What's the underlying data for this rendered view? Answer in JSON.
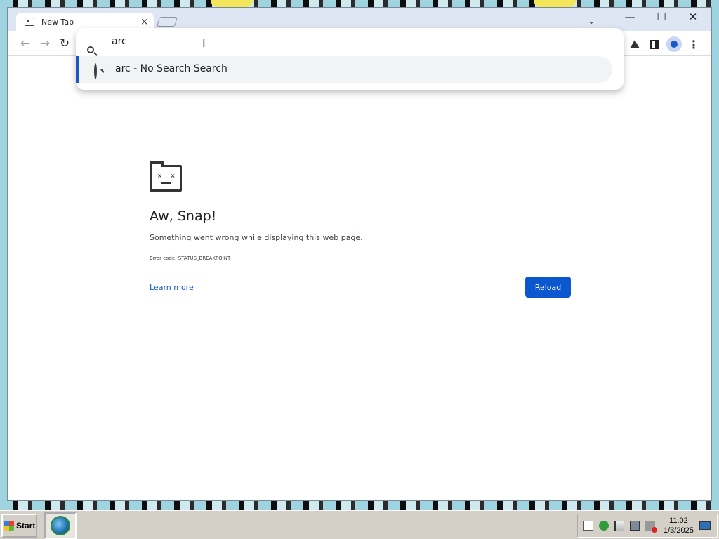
{
  "browser": {
    "tab": {
      "title": "New Tab",
      "close_label": "×"
    },
    "window_controls": {
      "minimize": "—",
      "maximize": "☐",
      "close": "✕"
    },
    "tab_search_label": "⌄",
    "nav": {
      "back": "←",
      "forward": "→",
      "reload": "↻"
    },
    "menu_label": "⋮"
  },
  "omnibox": {
    "query": "arc",
    "suggestion": "arc - No Search Search"
  },
  "error_page": {
    "title": "Aw, Snap!",
    "message": "Something went wrong while displaying this web page.",
    "error_code": "Error code: STATUS_BREAKPOINT",
    "learn_more": "Learn more",
    "reload_button": "Reload"
  },
  "taskbar": {
    "start_label": "Start",
    "clock_time": "11:02",
    "clock_date": "1/3/2025"
  },
  "colors": {
    "accent": "#0b57d0",
    "tabstrip": "#dfe6f3"
  }
}
